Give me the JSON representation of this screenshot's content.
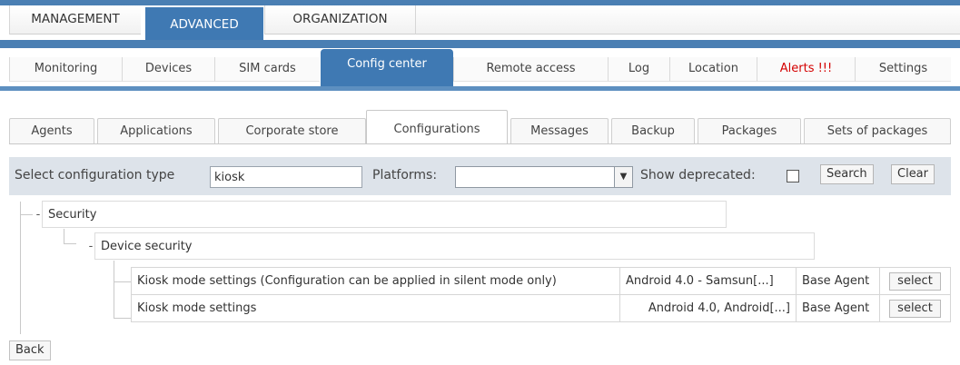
{
  "top_tabs": [
    {
      "label": "MANAGEMENT"
    },
    {
      "label": "ADVANCED",
      "active": true
    },
    {
      "label": "ORGANIZATION"
    }
  ],
  "sub_tabs": [
    {
      "label": "Monitoring"
    },
    {
      "label": "Devices"
    },
    {
      "label": "SIM cards"
    },
    {
      "label": "Config center",
      "active": true
    },
    {
      "label": "Remote access"
    },
    {
      "label": "Log"
    },
    {
      "label": "Location"
    },
    {
      "label": "Alerts !!!",
      "alert": true
    },
    {
      "label": "Settings"
    }
  ],
  "config_tabs": [
    {
      "label": "Agents"
    },
    {
      "label": "Applications"
    },
    {
      "label": "Corporate store"
    },
    {
      "label": "Configurations",
      "active": true
    },
    {
      "label": "Messages"
    },
    {
      "label": "Backup"
    },
    {
      "label": "Packages"
    },
    {
      "label": "Sets of packages"
    }
  ],
  "filter": {
    "type_label": "Select configuration type",
    "type_value": "kiosk",
    "platforms_label": "Platforms:",
    "platforms_value": "",
    "deprecated_label": "Show deprecated:",
    "deprecated_checked": false,
    "search_label": "Search",
    "clear_label": "Clear"
  },
  "tree": {
    "root": {
      "toggle": "-",
      "label": "Security"
    },
    "child": {
      "toggle": "-",
      "label": "Device security"
    },
    "rows": [
      {
        "name": "Kiosk mode settings (Configuration can be applied in silent mode only)",
        "platforms": "Android 4.0 - Samsun[...]",
        "agent": "Base Agent",
        "action": "select"
      },
      {
        "name": "Kiosk mode settings",
        "platforms": "Android 4.0, Android[...]",
        "agent": "Base Agent",
        "action": "select"
      }
    ]
  },
  "back_label": "Back",
  "colors": {
    "accent_blue": "#3f79b3",
    "alert_red": "#d40000",
    "filter_bg": "#dde3ea"
  }
}
